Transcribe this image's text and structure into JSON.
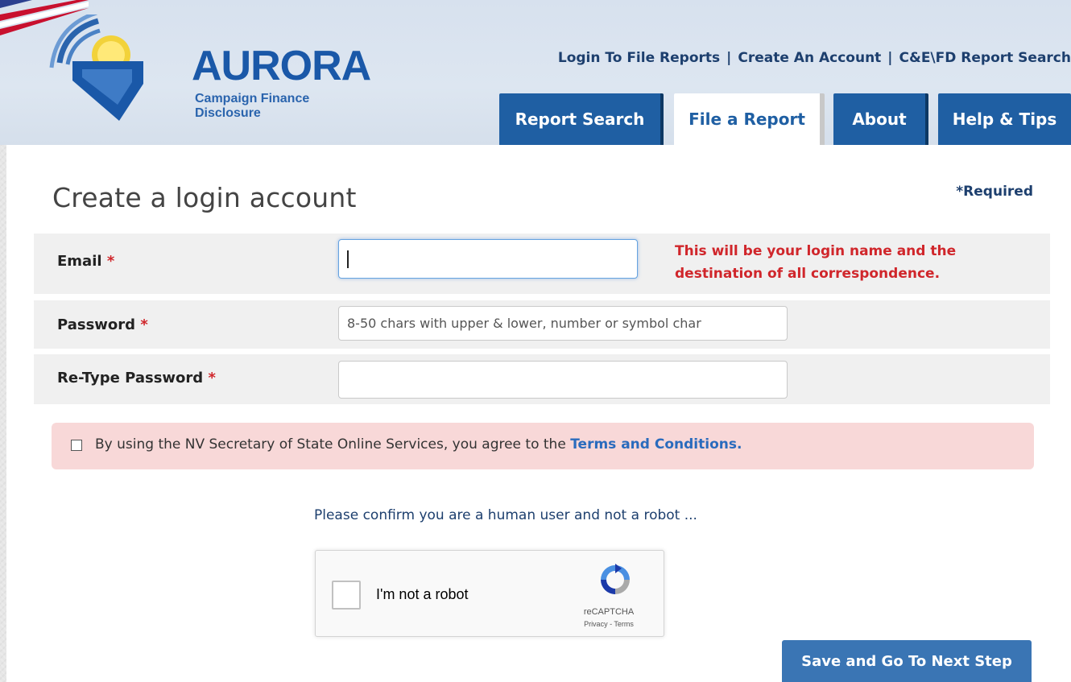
{
  "header": {
    "logo_title": "AURORA",
    "logo_subtitle": "Campaign Finance Disclosure",
    "top_links": [
      {
        "label": "Login To File Reports"
      },
      {
        "label": "Create An Account"
      },
      {
        "label": "C&E\\FD Report Search"
      }
    ],
    "top_link_separator": "|",
    "tabs": [
      {
        "label": "Report Search",
        "active": false
      },
      {
        "label": "File a Report",
        "active": true
      },
      {
        "label": "About",
        "active": false
      },
      {
        "label": "Help & Tips",
        "active": false
      }
    ]
  },
  "form": {
    "title": "Create a login account",
    "required_note": "*Required",
    "required_marker": "*",
    "email": {
      "label": "Email",
      "value": "",
      "hint": "This will be your login name and the destination of all correspondence."
    },
    "password": {
      "label": "Password",
      "value": "",
      "placeholder": "8-50 chars with upper & lower, number or symbol char"
    },
    "retype_password": {
      "label": "Re-Type Password",
      "value": ""
    },
    "terms": {
      "checked": false,
      "text": "By using the NV Secretary of State Online Services, you agree to the ",
      "link_label": "Terms and Conditions."
    },
    "captcha_prompt": "Please confirm you are a human user and not a robot ...",
    "recaptcha": {
      "label": "I'm not a robot",
      "brand": "reCAPTCHA",
      "privacy": "Privacy",
      "terms_sep": " - ",
      "terms": "Terms"
    },
    "submit_label": "Save and Go To Next Step"
  },
  "colors": {
    "brand_blue": "#1f5fa3",
    "required_red": "#d0262b",
    "link_blue": "#2a6bbd",
    "notice_pink": "#f8d8d8",
    "button_blue": "#3a75b4"
  }
}
